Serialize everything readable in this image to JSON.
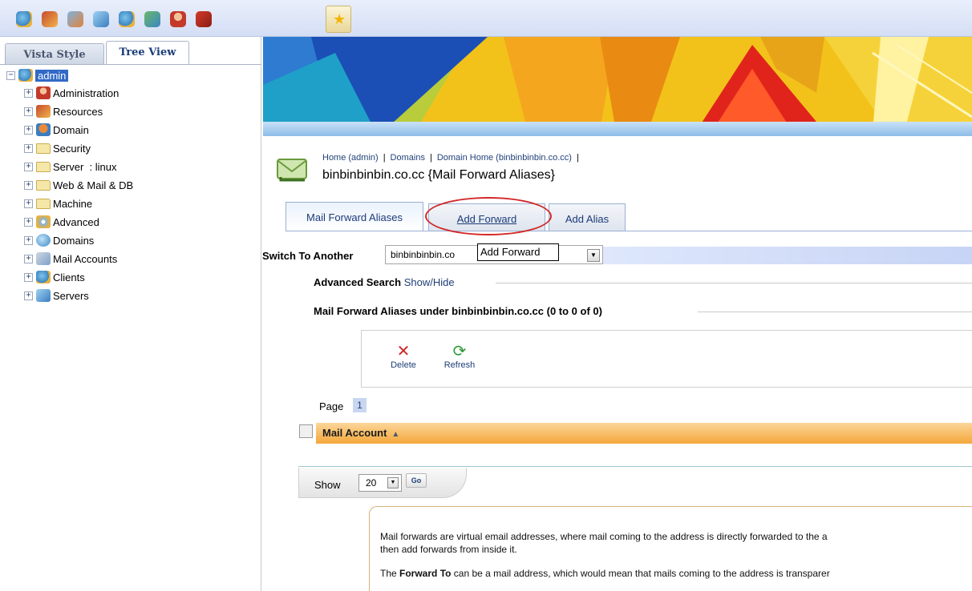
{
  "colors": {
    "selection": "#3169c6",
    "accent": "#f4a73a",
    "tooltip_border": "#000000",
    "annotation": "#d22828"
  },
  "toolbar": {
    "icons": [
      "clients-icon",
      "resources-icon",
      "mail-icon",
      "servers-icon",
      "admin-icon",
      "web-icon",
      "user-icon",
      "logout-icon",
      "favorite-star-icon"
    ]
  },
  "left": {
    "tabs": [
      "Vista Style",
      "Tree View"
    ],
    "root": "admin",
    "nodes": [
      "Administration",
      "Resources",
      "Domain",
      "Security",
      "Server  : linux",
      "Web & Mail & DB",
      "Machine",
      "Advanced",
      "Domains",
      "Mail Accounts",
      "Clients",
      "Servers"
    ]
  },
  "breadcrumb": {
    "items": [
      "Home (admin)",
      "Domains",
      "Domain Home (binbinbinbin.co.cc)"
    ],
    "separator": "|",
    "title": "binbinbinbin.co.cc {Mail Forward Aliases}"
  },
  "tabs": [
    "Mail Forward Aliases",
    "Add Forward",
    "Add Alias"
  ],
  "switch": {
    "label": "Switch To Another",
    "value": "binbinbinbin.co",
    "tooltip": "Add Forward"
  },
  "sections": {
    "advanced_label": "Advanced Search",
    "advanced_link": "Show/Hide",
    "list_title": "Mail Forward Aliases under binbinbinbin.co.cc (0 to 0 of 0)"
  },
  "actions": {
    "delete": "Delete",
    "refresh": "Refresh"
  },
  "paging": {
    "label": "Page",
    "current": "1"
  },
  "table": {
    "column": "Mail Account",
    "sort_glyph": "▲"
  },
  "show": {
    "label": "Show",
    "value": "20",
    "go": "Go"
  },
  "help": {
    "line1": "Mail forwards are virtual email addresses, where mail coming to the address is directly forwarded to the a",
    "line2": "then add forwards from inside it.",
    "line3_pre": "The ",
    "line3_bold": "Forward To",
    "line3_post": " can be a mail address, which would mean that mails coming to the address is transparer"
  }
}
